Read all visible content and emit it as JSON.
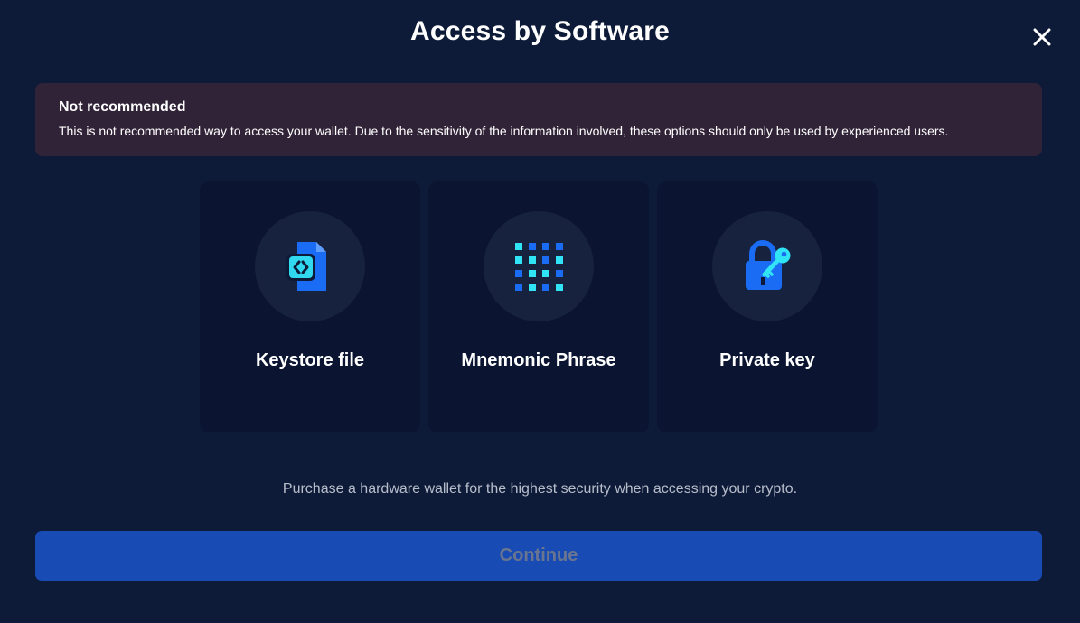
{
  "header": {
    "title": "Access by Software",
    "close_icon": "close-icon"
  },
  "warning": {
    "title": "Not recommended",
    "text": "This is not recommended way to access your wallet. Due to the sensitivity of the information involved, these options should only be used by experienced users.",
    "background": "#312337"
  },
  "options": [
    {
      "label": "Keystore file",
      "icon": "keystore-file-icon"
    },
    {
      "label": "Mnemonic Phrase",
      "icon": "mnemonic-grid-icon"
    },
    {
      "label": "Private key",
      "icon": "padlock-key-icon"
    }
  ],
  "hint": "Purchase a hardware wallet for the highest security when accessing your crypto.",
  "continue_button": {
    "label": "Continue",
    "enabled": false
  },
  "colors": {
    "background": "#0e1b38",
    "card": "#0b1531",
    "accent_blue": "#1a6cf5",
    "accent_cyan": "#30e3f5",
    "button": "#184bb3"
  }
}
